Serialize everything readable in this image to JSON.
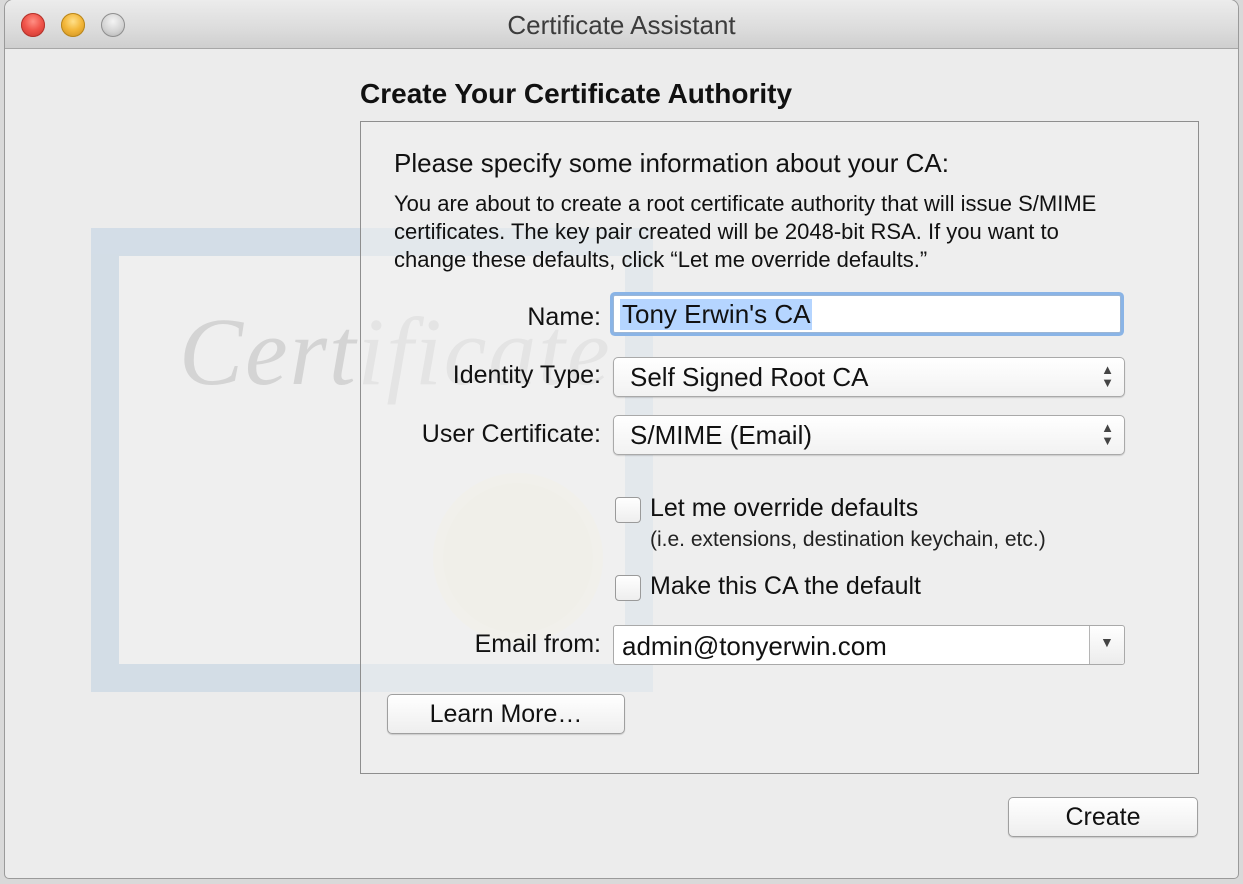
{
  "window": {
    "title": "Certificate Assistant"
  },
  "heading": "Create Your Certificate Authority",
  "panel": {
    "subheading": "Please specify some information about your CA:",
    "description": "You are about to create a root certificate authority that will issue S/MIME certificates. The key pair created will be 2048-bit RSA. If you want to change these defaults, click “Let me override defaults.”"
  },
  "form": {
    "name_label": "Name:",
    "name_value": "Tony Erwin's CA",
    "identity_type_label": "Identity Type:",
    "identity_type_value": "Self Signed Root CA",
    "user_cert_label": "User Certificate:",
    "user_cert_value": "S/MIME (Email)",
    "override_label": "Let me override defaults",
    "override_checked": false,
    "override_note": "(i.e. extensions, destination keychain, etc.)",
    "default_label": "Make this CA the default",
    "default_checked": false,
    "email_label": "Email from:",
    "email_value": "admin@tonyerwin.com"
  },
  "buttons": {
    "learn_more": "Learn More…",
    "create": "Create"
  },
  "artwork": {
    "word": "Certificate"
  },
  "icons": {
    "popup_arrows": "updown-arrows-icon",
    "combo_arrow": "chevron-down-icon"
  }
}
